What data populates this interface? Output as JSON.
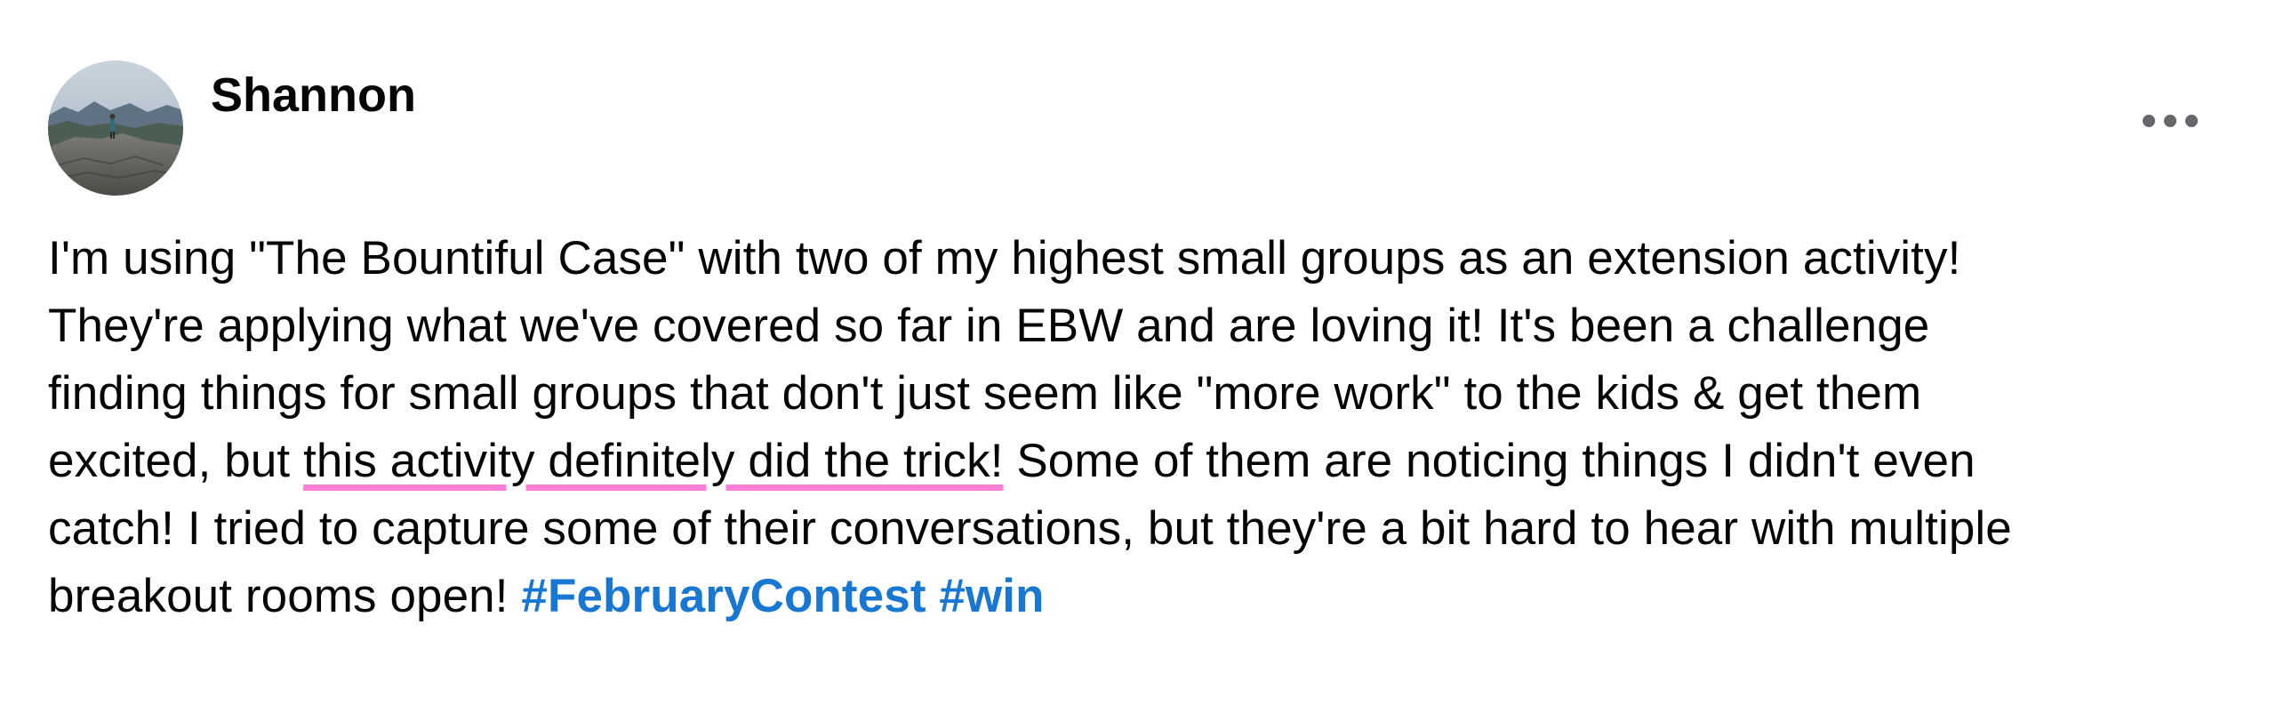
{
  "post": {
    "author": "Shannon",
    "avatar_alt": "Profile photo",
    "menu_icon": "more-horizontal-icon",
    "body": {
      "line1": "I'm using \"The Bountiful Case\" with two of my highest small groups as an extension activity!",
      "line2": "They're applying what we've covered so far in EBW and are loving it! It's been a challenge",
      "line3": "finding things for small groups that don't just seem like \"more work\" to the kids & get them",
      "line4_before": "excited, but ",
      "line4_highlight": "this activity definitely did the trick!",
      "line4_after": " Some of them are noticing things I didn't even",
      "line5": "catch! I tried to capture some of their conversations, but they're a bit hard to hear with multiple",
      "line6": "breakout rooms open! "
    },
    "hashtags": [
      "#FebruaryContest",
      "#win"
    ],
    "highlight_color": "#ff7fd6",
    "hashtag_color": "#1877d2"
  }
}
